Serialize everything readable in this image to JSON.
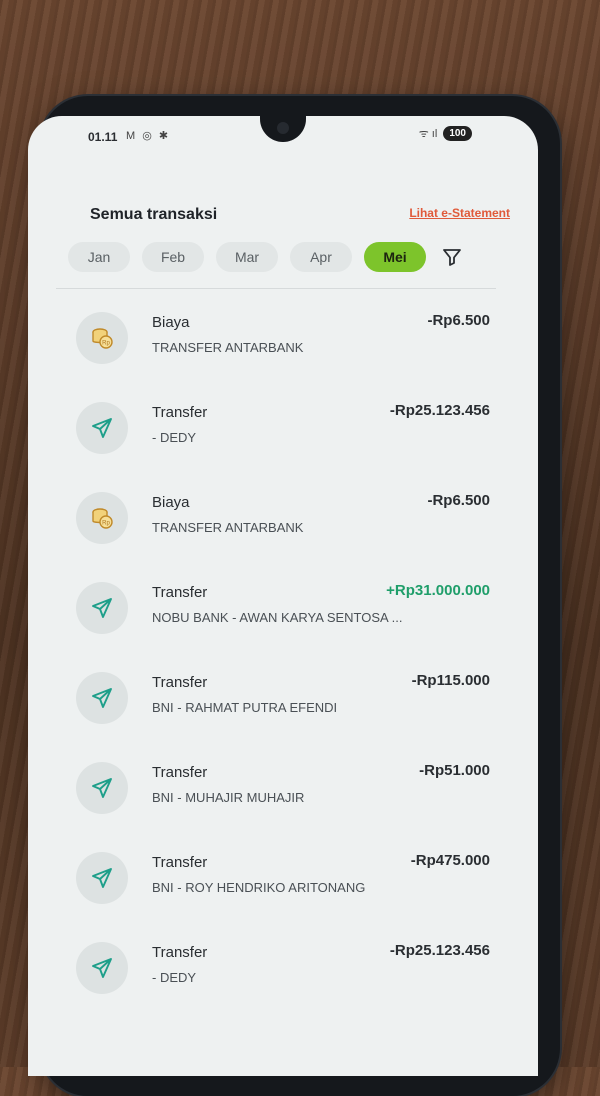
{
  "status": {
    "time": "01.11",
    "left_icons": "M ◎ ✱",
    "signal": "ᯤ ıl",
    "battery": "100"
  },
  "header": {
    "title": "Semua transaksi",
    "estatement_link": "Lihat e-Statement"
  },
  "months": {
    "items": [
      "Jan",
      "Feb",
      "Mar",
      "Apr",
      "Mei"
    ],
    "selected": "Mei"
  },
  "transactions": [
    {
      "type": "Biaya",
      "desc": "TRANSFER ANTARBANK",
      "amount": "-Rp6.500",
      "icon": "coins-icon"
    },
    {
      "type": "Transfer",
      "desc": "- DEDY",
      "amount": "-Rp25.123.456",
      "icon": "send-icon"
    },
    {
      "type": "Biaya",
      "desc": "TRANSFER ANTARBANK",
      "amount": "-Rp6.500",
      "icon": "coins-icon"
    },
    {
      "type": "Transfer",
      "desc": "NOBU BANK - AWAN KARYA SENTOSA ...",
      "amount": "+Rp31.000.000",
      "icon": "send-icon"
    },
    {
      "type": "Transfer",
      "desc": "BNI - RAHMAT PUTRA EFENDI",
      "amount": "-Rp115.000",
      "icon": "send-icon"
    },
    {
      "type": "Transfer",
      "desc": "BNI - MUHAJIR MUHAJIR",
      "amount": "-Rp51.000",
      "icon": "send-icon"
    },
    {
      "type": "Transfer",
      "desc": "BNI - ROY HENDRIKO ARITONANG",
      "amount": "-Rp475.000",
      "icon": "send-icon"
    },
    {
      "type": "Transfer",
      "desc": "- DEDY",
      "amount": "-Rp25.123.456",
      "icon": "send-icon"
    }
  ],
  "colors": {
    "accent": "#7dc42b",
    "positive": "#1f9e6a",
    "link": "#e05a3a"
  }
}
